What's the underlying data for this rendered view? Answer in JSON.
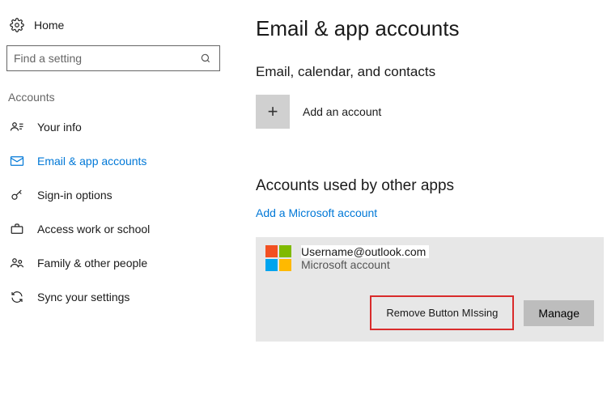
{
  "sidebar": {
    "home_label": "Home",
    "search_placeholder": "Find a setting",
    "section_label": "Accounts",
    "items": [
      {
        "label": "Your info"
      },
      {
        "label": "Email & app accounts"
      },
      {
        "label": "Sign-in options"
      },
      {
        "label": "Access work or school"
      },
      {
        "label": "Family & other people"
      },
      {
        "label": "Sync your settings"
      }
    ]
  },
  "content": {
    "title": "Email & app accounts",
    "section1": "Email, calendar, and contacts",
    "add_account_label": "Add an account",
    "section2": "Accounts used by other apps",
    "add_ms_link": "Add a Microsoft account",
    "account": {
      "username": "Username@outlook.com",
      "type": "Microsoft account"
    },
    "missing_note": "Remove Button MIssing",
    "manage_label": "Manage"
  }
}
